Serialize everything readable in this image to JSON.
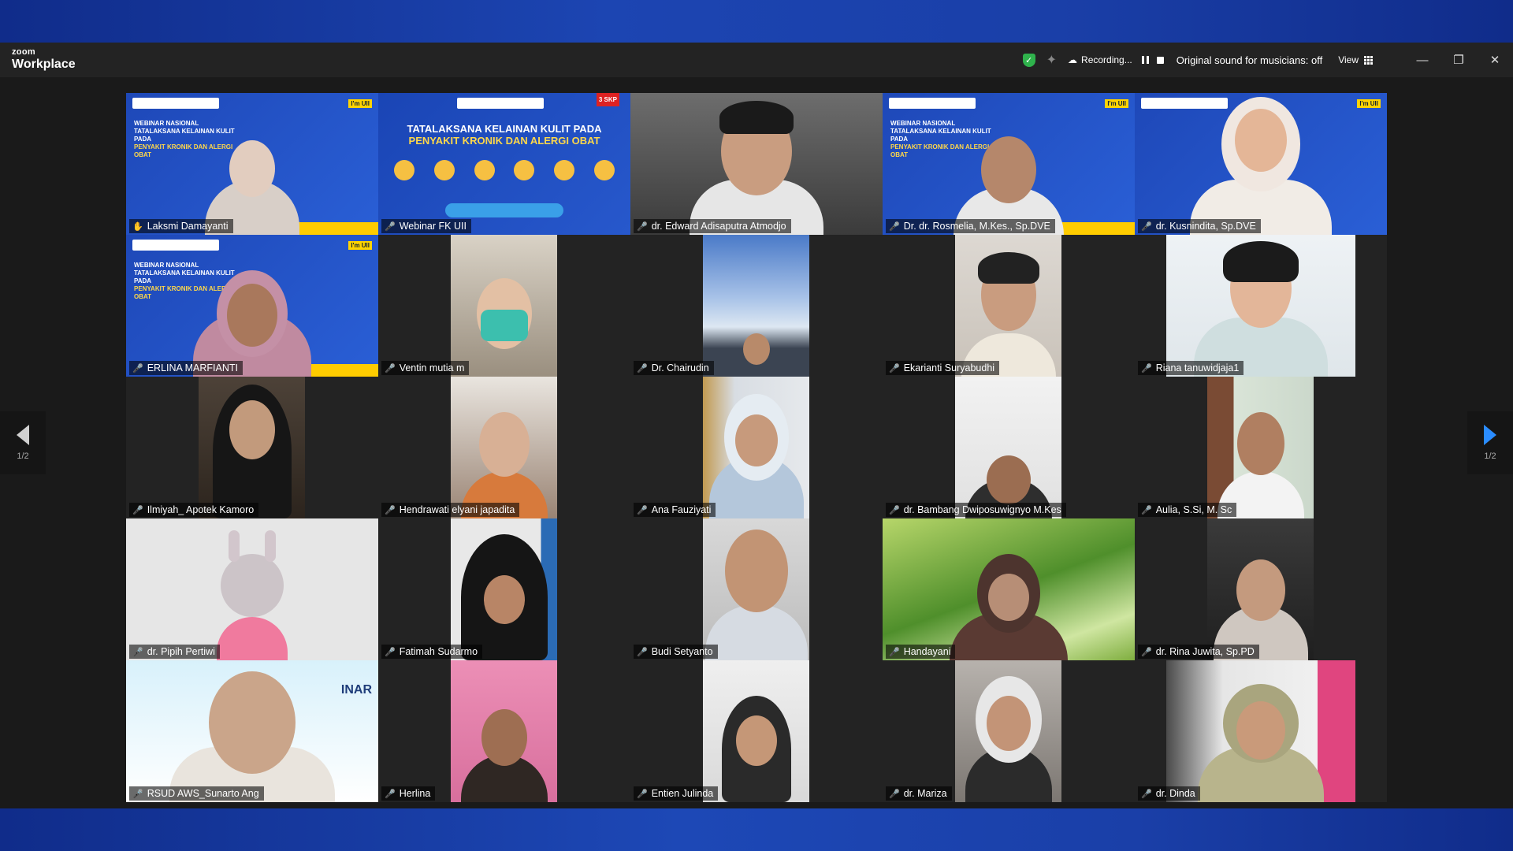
{
  "app": {
    "brand_small": "zoom",
    "brand_big": "Workplace"
  },
  "toolbar": {
    "recording_label": "Recording...",
    "original_sound": "Original sound for musicians: off",
    "view_label": "View"
  },
  "colors": {
    "accent_active": "#23d96e",
    "muted_red": "#ff4d4d",
    "nav_blue": "#2a8cff",
    "secure_green": "#2fb24c"
  },
  "banner": {
    "line1": "WEBINAR NASIONAL",
    "line2": "TATALAKSANA KELAINAN KULIT PADA",
    "line3": "PENYAKIT KRONIK DAN ALERGI OBAT",
    "badge": "I'm UII",
    "skp": "3 SKP"
  },
  "pagination": {
    "left": "1/2",
    "right": "1/2"
  },
  "participants": [
    {
      "name": "Laksmi Damayanti",
      "host": true
    },
    {
      "name": "Webinar FK UII"
    },
    {
      "name": "dr. Edward Adisaputra Atmodjo"
    },
    {
      "name": "Dr. dr. Rosmelia, M.Kes., Sp.DVE"
    },
    {
      "name": "dr. Kusnindita, Sp.DVE"
    },
    {
      "name": "ERLINA MARFIANTI"
    },
    {
      "name": "Ventin mutia m"
    },
    {
      "name": "Dr. Chairudin"
    },
    {
      "name": "Ekarianti Suryabudhi"
    },
    {
      "name": "Riana tanuwidjaja1"
    },
    {
      "name": "Ilmiyah_ Apotek Kamoro"
    },
    {
      "name": "Hendrawati elyani japadita"
    },
    {
      "name": "Ana Fauziyati"
    },
    {
      "name": "dr. Bambang Dwiposuwignyo M.Kes"
    },
    {
      "name": "Aulia, S.Si, M. Sc"
    },
    {
      "name": "dr. Pipih Pertiwi"
    },
    {
      "name": "Fatimah Sudarmo"
    },
    {
      "name": "Budi Setyanto"
    },
    {
      "name": "Handayani"
    },
    {
      "name": "dr. Rina Juwita, Sp.PD"
    },
    {
      "name": "RSUD AWS_Sunarto Ang"
    },
    {
      "name": "Herlina"
    },
    {
      "name": "Entien Julinda"
    },
    {
      "name": "dr. Mariza"
    },
    {
      "name": "dr. Dinda"
    }
  ]
}
